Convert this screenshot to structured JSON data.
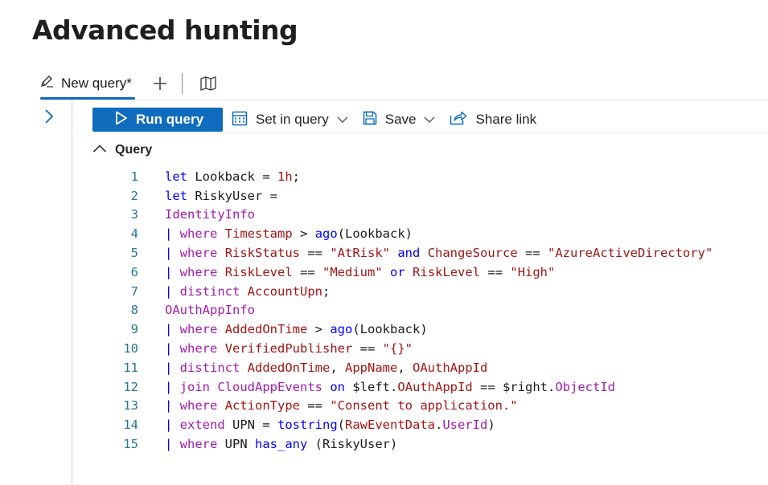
{
  "page": {
    "title": "Advanced hunting"
  },
  "tabs": [
    {
      "label": "New query*"
    }
  ],
  "toolbar": {
    "run_label": "Run query",
    "set_in_query_label": "Set in query",
    "save_label": "Save",
    "share_label": "Share link"
  },
  "section": {
    "label": "Query"
  },
  "colors": {
    "accent": "#0f6cbd",
    "line_number": "#237893",
    "keyword": "#0000ff",
    "string": "#a31515",
    "table": "#a21caf"
  },
  "code": [
    {
      "n": "1",
      "tokens": [
        {
          "t": "let",
          "c": "kw"
        },
        {
          "t": " Lookback = ",
          "c": "pl"
        },
        {
          "t": "1h",
          "c": "st"
        },
        {
          "t": ";",
          "c": "pl"
        }
      ]
    },
    {
      "n": "2",
      "tokens": [
        {
          "t": "let",
          "c": "kw"
        },
        {
          "t": " RiskyUser =",
          "c": "pl"
        }
      ]
    },
    {
      "n": "3",
      "tokens": [
        {
          "t": "IdentityInfo",
          "c": "tb"
        }
      ]
    },
    {
      "n": "4",
      "tokens": [
        {
          "t": "| ",
          "c": "pipe"
        },
        {
          "t": "where",
          "c": "tb"
        },
        {
          "t": " ",
          "c": "pl"
        },
        {
          "t": "Timestamp",
          "c": "ty"
        },
        {
          "t": " > ",
          "c": "pl"
        },
        {
          "t": "ago",
          "c": "kw"
        },
        {
          "t": "(Lookback)",
          "c": "pl"
        }
      ]
    },
    {
      "n": "5",
      "tokens": [
        {
          "t": "| ",
          "c": "pipe"
        },
        {
          "t": "where",
          "c": "tb"
        },
        {
          "t": " ",
          "c": "pl"
        },
        {
          "t": "RiskStatus",
          "c": "ty"
        },
        {
          "t": " == ",
          "c": "pl"
        },
        {
          "t": "\"AtRisk\"",
          "c": "st"
        },
        {
          "t": " ",
          "c": "pl"
        },
        {
          "t": "and",
          "c": "kw"
        },
        {
          "t": " ",
          "c": "pl"
        },
        {
          "t": "ChangeSource",
          "c": "ty"
        },
        {
          "t": " == ",
          "c": "pl"
        },
        {
          "t": "\"AzureActiveDirectory\"",
          "c": "st"
        }
      ]
    },
    {
      "n": "6",
      "tokens": [
        {
          "t": "| ",
          "c": "pipe"
        },
        {
          "t": "where",
          "c": "tb"
        },
        {
          "t": " ",
          "c": "pl"
        },
        {
          "t": "RiskLevel",
          "c": "ty"
        },
        {
          "t": " == ",
          "c": "pl"
        },
        {
          "t": "\"Medium\"",
          "c": "st"
        },
        {
          "t": " ",
          "c": "pl"
        },
        {
          "t": "or",
          "c": "kw"
        },
        {
          "t": " ",
          "c": "pl"
        },
        {
          "t": "RiskLevel",
          "c": "ty"
        },
        {
          "t": " == ",
          "c": "pl"
        },
        {
          "t": "\"High\"",
          "c": "st"
        }
      ]
    },
    {
      "n": "7",
      "tokens": [
        {
          "t": "| ",
          "c": "pipe"
        },
        {
          "t": "distinct",
          "c": "tb"
        },
        {
          "t": " ",
          "c": "pl"
        },
        {
          "t": "AccountUpn",
          "c": "ty"
        },
        {
          "t": ";",
          "c": "pl"
        }
      ]
    },
    {
      "n": "8",
      "tokens": [
        {
          "t": "OAuthAppInfo",
          "c": "tb"
        }
      ]
    },
    {
      "n": "9",
      "tokens": [
        {
          "t": "| ",
          "c": "pipe"
        },
        {
          "t": "where",
          "c": "tb"
        },
        {
          "t": " ",
          "c": "pl"
        },
        {
          "t": "AddedOnTime",
          "c": "ty"
        },
        {
          "t": " > ",
          "c": "pl"
        },
        {
          "t": "ago",
          "c": "kw"
        },
        {
          "t": "(Lookback)",
          "c": "pl"
        }
      ]
    },
    {
      "n": "10",
      "tokens": [
        {
          "t": "| ",
          "c": "pipe"
        },
        {
          "t": "where",
          "c": "tb"
        },
        {
          "t": " ",
          "c": "pl"
        },
        {
          "t": "VerifiedPublisher",
          "c": "ty"
        },
        {
          "t": " == ",
          "c": "pl"
        },
        {
          "t": "\"{}\"",
          "c": "st"
        }
      ]
    },
    {
      "n": "11",
      "tokens": [
        {
          "t": "| ",
          "c": "pipe"
        },
        {
          "t": "distinct",
          "c": "tb"
        },
        {
          "t": " ",
          "c": "pl"
        },
        {
          "t": "AddedOnTime",
          "c": "ty"
        },
        {
          "t": ", ",
          "c": "pl"
        },
        {
          "t": "AppName",
          "c": "ty"
        },
        {
          "t": ", ",
          "c": "pl"
        },
        {
          "t": "OAuthAppId",
          "c": "ty"
        }
      ]
    },
    {
      "n": "12",
      "tokens": [
        {
          "t": "| ",
          "c": "pipe"
        },
        {
          "t": "join",
          "c": "tb"
        },
        {
          "t": " ",
          "c": "pl"
        },
        {
          "t": "CloudAppEvents",
          "c": "tb"
        },
        {
          "t": " ",
          "c": "pl"
        },
        {
          "t": "on",
          "c": "kw"
        },
        {
          "t": " $left.",
          "c": "pl"
        },
        {
          "t": "OAuthAppId",
          "c": "ty"
        },
        {
          "t": " == $right.",
          "c": "pl"
        },
        {
          "t": "ObjectId",
          "c": "tb"
        }
      ]
    },
    {
      "n": "13",
      "tokens": [
        {
          "t": "| ",
          "c": "pipe"
        },
        {
          "t": "where",
          "c": "tb"
        },
        {
          "t": " ",
          "c": "pl"
        },
        {
          "t": "ActionType",
          "c": "ty"
        },
        {
          "t": " == ",
          "c": "pl"
        },
        {
          "t": "\"Consent to application.\"",
          "c": "st"
        }
      ]
    },
    {
      "n": "14",
      "tokens": [
        {
          "t": "| ",
          "c": "pipe"
        },
        {
          "t": "extend",
          "c": "tb"
        },
        {
          "t": " UPN = ",
          "c": "pl"
        },
        {
          "t": "tostring",
          "c": "kw"
        },
        {
          "t": "(",
          "c": "pl"
        },
        {
          "t": "RawEventData",
          "c": "ty"
        },
        {
          "t": ".",
          "c": "pl"
        },
        {
          "t": "UserId",
          "c": "tb"
        },
        {
          "t": ")",
          "c": "pl"
        }
      ]
    },
    {
      "n": "15",
      "tokens": [
        {
          "t": "| ",
          "c": "pipe"
        },
        {
          "t": "where",
          "c": "tb"
        },
        {
          "t": " UPN ",
          "c": "pl"
        },
        {
          "t": "has_any",
          "c": "kw"
        },
        {
          "t": " (RiskyUser)",
          "c": "pl"
        }
      ]
    }
  ]
}
